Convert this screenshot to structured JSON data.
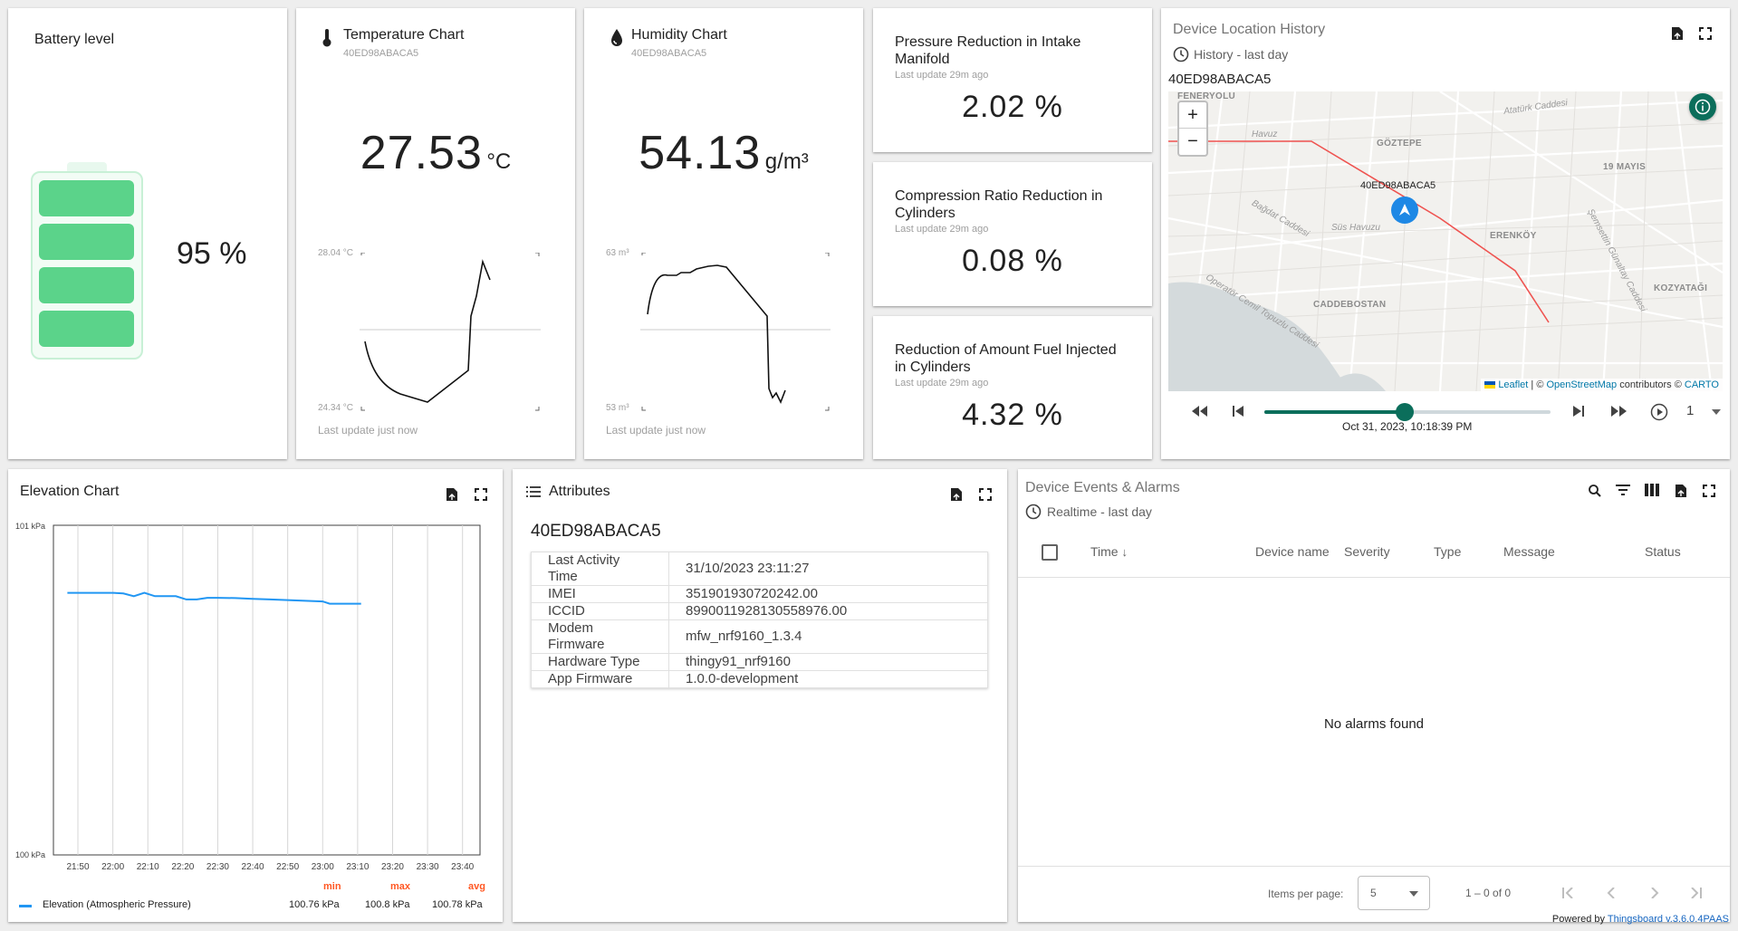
{
  "battery": {
    "title": "Battery level",
    "value": "95 %",
    "level_fraction": 0.95
  },
  "temperature": {
    "title": "Temperature Chart",
    "device": "40ED98ABACA5",
    "value": "27.53",
    "unit": "°C",
    "max_label": "28.04 °C",
    "min_label": "24.34 °C",
    "footer": "Last update just now"
  },
  "humidity": {
    "title": "Humidity Chart",
    "device": "40ED98ABACA5",
    "value": "54.13",
    "unit": "g/m³",
    "max_label": "63 m³",
    "min_label": "53 m³",
    "footer": "Last update just now"
  },
  "kpis": [
    {
      "title_line1": "Pressure Reduction in Intake",
      "title_line2": "Manifold",
      "sub": "Last update 29m ago",
      "value": "2.02 %"
    },
    {
      "title_line1": "Compression Ratio Reduction in",
      "title_line2": "Cylinders",
      "sub": "Last update 29m ago",
      "value": "0.08 %"
    },
    {
      "title_line1": "Reduction of Amount Fuel Injected",
      "title_line2": "in Cylinders",
      "sub": "Last update 29m ago",
      "value": "4.32 %"
    }
  ],
  "map": {
    "title": "Device Location History",
    "history": "History - last day",
    "device": "40ED98ABACA5",
    "marker_label": "40ED98ABACA5",
    "labels": [
      "FENERYOLU",
      "GÖZTEPE",
      "19 MAYIS",
      "ERENKÖY",
      "KOZYATAĞI",
      "CADDEBOSTAN"
    ],
    "italic_labels": [
      "Havuz",
      "Atatürk Caddesi",
      "Bağdat Caddesi",
      "Süs Havuzu",
      "Operatör Cemil Topuzlu Caddesi",
      "Şemsettin Günaltay Caddesi"
    ],
    "attribution_leaflet": "Leaflet",
    "attribution_mid": " | © ",
    "attribution_osm": "OpenStreetMap",
    "attribution_contrib": " contributors © ",
    "attribution_carto": "CARTO",
    "zoom_in": "+",
    "zoom_out": "−",
    "timestamp": "Oct 31, 2023, 10:18:39 PM",
    "speed": "1",
    "progress_fraction": 0.49
  },
  "elevation": {
    "title": "Elevation Chart",
    "legend_name": "Elevation (Atmospheric Pressure)",
    "stat_headers": [
      "min",
      "max",
      "avg"
    ],
    "stat_values": [
      "100.76 kPa",
      "100.8 kPa",
      "100.78 kPa"
    ]
  },
  "chart_data": {
    "type": "line",
    "title": "",
    "xlabel": "",
    "ylabel": "",
    "ylim": [
      100,
      101
    ],
    "ytick_labels": [
      "101 kPa",
      "100 kPa"
    ],
    "xtick_labels": [
      "21:50",
      "22:00",
      "22:10",
      "22:20",
      "22:30",
      "22:40",
      "22:50",
      "23:00",
      "23:10",
      "23:20",
      "23:30",
      "23:40"
    ],
    "grid": true,
    "legend": "bottom",
    "series": [
      {
        "name": "Elevation (Atmospheric Pressure)",
        "color": "#2196f3",
        "x": [
          "21:47",
          "21:52",
          "21:57",
          "22:00",
          "22:03",
          "22:06",
          "22:09",
          "22:12",
          "22:15",
          "22:18",
          "22:21",
          "22:24",
          "22:27",
          "22:30",
          "22:35",
          "22:40",
          "22:45",
          "22:50",
          "22:55",
          "23:00",
          "23:02",
          "23:05",
          "23:08",
          "23:11"
        ],
        "values": [
          100.795,
          100.795,
          100.795,
          100.795,
          100.793,
          100.785,
          100.795,
          100.785,
          100.785,
          100.785,
          100.775,
          100.775,
          100.78,
          100.78,
          100.779,
          100.777,
          100.775,
          100.773,
          100.771,
          100.769,
          100.762,
          100.762,
          100.762,
          100.762
        ]
      }
    ]
  },
  "attributes": {
    "title": "Attributes",
    "device": "40ED98ABACA5",
    "rows": [
      {
        "key": "Last Activity Time",
        "value": "31/10/2023 23:11:27"
      },
      {
        "key": "IMEI",
        "value": "351901930720242.00"
      },
      {
        "key": "ICCID",
        "value": "8990011928130558976.00"
      },
      {
        "key": "Modem Firmware",
        "value": "mfw_nrf9160_1.3.4"
      },
      {
        "key": "Hardware Type",
        "value": "thingy91_nrf9160"
      },
      {
        "key": "App Firmware",
        "value": "1.0.0-development"
      }
    ]
  },
  "alarms": {
    "title": "Device Events & Alarms",
    "realtime": "Realtime - last day",
    "columns": [
      "Time",
      "Device name",
      "Severity",
      "Type",
      "Message",
      "Status"
    ],
    "empty": "No alarms found",
    "items_per_page_label": "Items per page:",
    "items_per_page": "5",
    "range": "1 – 0 of 0"
  },
  "footer": {
    "powered_by": "Powered by",
    "version_link": "Thingsboard v.3.6.0.4PAAS"
  },
  "colors": {
    "battery_fill": "#5bd38a",
    "battery_outline": "#c8f0d6",
    "accent_teal": "#0b6e5b",
    "series_blue": "#2196f3",
    "stat_orange": "#ff5722",
    "route_red": "#ef5350",
    "marker_blue": "#1e88e5"
  }
}
